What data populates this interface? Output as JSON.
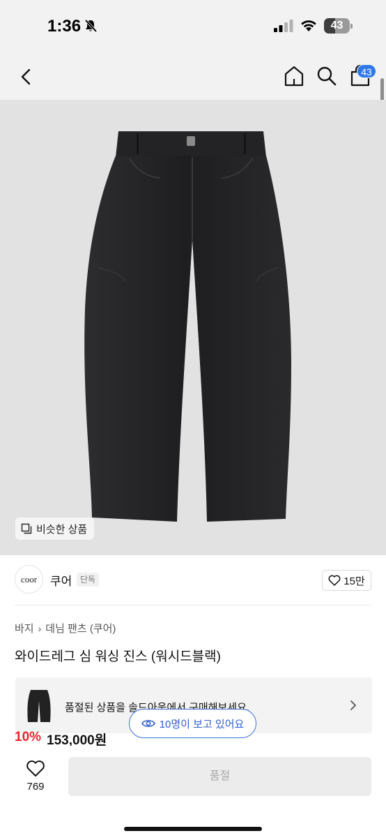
{
  "status_bar": {
    "time": "1:36",
    "battery_text": "43",
    "battery_level": 0.43
  },
  "header": {
    "cart_badge": "43"
  },
  "product": {
    "similar_label": "비슷한 상품",
    "breadcrumb": [
      "바지",
      "데님 팬츠 (쿠어)"
    ],
    "title": "와이드레그 심 워싱 진스 (워시드블랙)",
    "discount": "10%",
    "price": "153,000원"
  },
  "brand": {
    "logo_text": "coor",
    "name": "쿠어",
    "tag": "단독",
    "likes": "15만"
  },
  "soldout": {
    "text": "품절된 상품을 솔드아웃에서 구매해보세요."
  },
  "viewers": {
    "text": "10명이 보고 있어요"
  },
  "bottom": {
    "wish_count": "769",
    "buy_label": "품절"
  }
}
